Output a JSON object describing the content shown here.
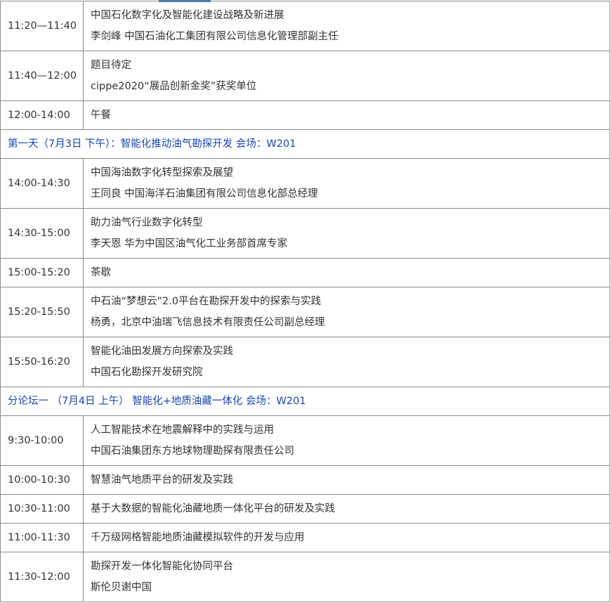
{
  "rows": [
    {
      "type": "session",
      "time": "11:20—11:40",
      "lines": [
        "中国石化数字化及智能化建设战略及新进展",
        "李剑峰 中国石油化工集团有限公司信息化管理部副主任"
      ]
    },
    {
      "type": "session",
      "time": "11:40—12:00",
      "lines": [
        "题目待定",
        "cippe2020“展品创新金奖”获奖单位"
      ]
    },
    {
      "type": "session",
      "time": "12:00-14:00",
      "lines": [
        "午餐"
      ]
    },
    {
      "type": "section",
      "text": "第一天（7月3日 下午）：智能化推动油气勘探开发  会场：W201"
    },
    {
      "type": "session",
      "time": "14:00-14:30",
      "lines": [
        "中国海油数字化转型探索及展望",
        "王同良 中国海洋石油集团有限公司信息化部总经理"
      ]
    },
    {
      "type": "session",
      "time": "14:30-15:00",
      "lines": [
        "助力油气行业数字化转型",
        "李天恩 华为中国区油气化工业务部首席专家"
      ]
    },
    {
      "type": "session",
      "time": "15:00-15:20",
      "lines": [
        "茶歇"
      ]
    },
    {
      "type": "session",
      "time": "15:20-15:50",
      "lines": [
        "中石油“梦想云”2.0平台在勘探开发中的探索与实践",
        "杨勇，北京中油瑞飞信息技术有限责任公司副总经理"
      ]
    },
    {
      "type": "session",
      "time": "15:50-16:20",
      "lines": [
        "智能化油田发展方向探索及实践",
        "中国石化勘探开发研究院"
      ]
    },
    {
      "type": "section",
      "text": "分论坛一 （7月4日  上午）  智能化+地质油藏一体化    会场：W201"
    },
    {
      "type": "session",
      "time": "9:30-10:00",
      "lines": [
        "人工智能技术在地震解释中的实践与运用",
        "中国石油集团东方地球物理勘探有限责任公司"
      ]
    },
    {
      "type": "session",
      "time": "10:00-10:30",
      "lines": [
        "智慧油气地质平台的研发及实践"
      ]
    },
    {
      "type": "session",
      "time": "10:30-11:00",
      "lines": [
        "基于大数据的智能化油藏地质一体化平台的研发及实践"
      ]
    },
    {
      "type": "session",
      "time": "11:00-11:30",
      "lines": [
        "千万级网格智能地质油藏模拟软件的开发与应用"
      ]
    },
    {
      "type": "session",
      "time": "11:30-12:00",
      "lines": [
        "勘探开发一体化智能化协同平台",
        "斯伦贝谢中国"
      ]
    }
  ]
}
